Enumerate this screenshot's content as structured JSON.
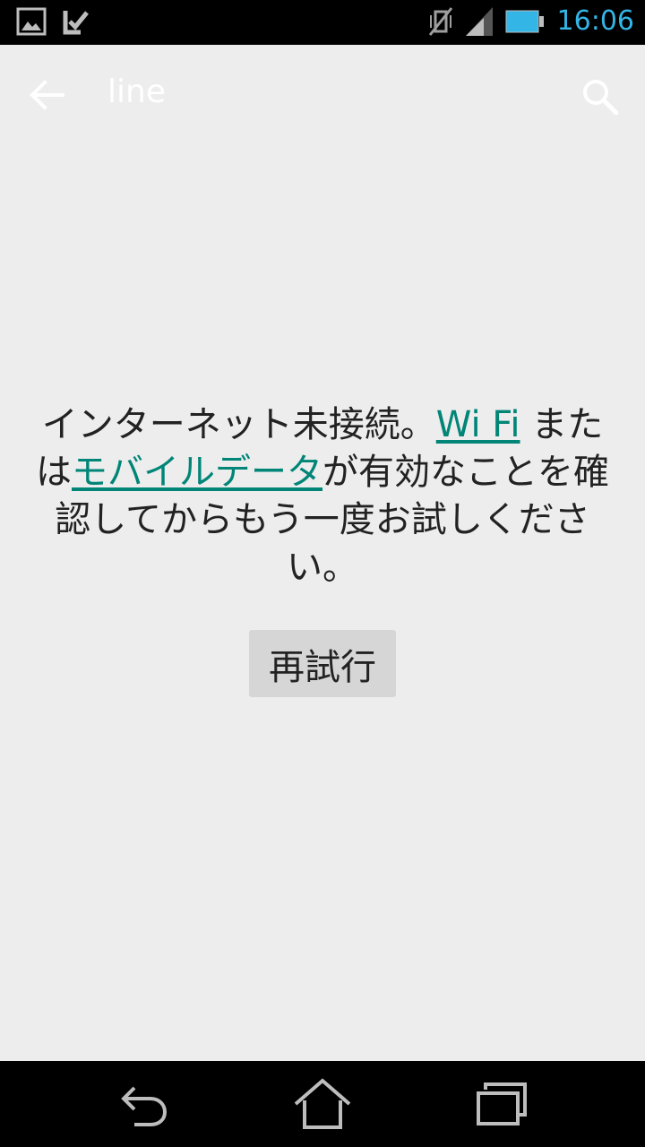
{
  "status_bar": {
    "time": "16:06",
    "left_icons": [
      "image-notification-icon",
      "task-check-notification-icon"
    ],
    "right_icons": [
      "vibrate-off-icon",
      "signal-icon",
      "battery-icon"
    ],
    "clock_color": "#33b5e5"
  },
  "action_bar": {
    "title": "line",
    "back_icon": "arrow-left-icon",
    "search_icon": "search-icon"
  },
  "message": {
    "text_1": "インターネット未接続。",
    "link_wifi": "Wi Fi",
    "text_2": " または",
    "link_mobile": "モバイルデータ",
    "text_3": "が有効なことを確認してからもう一度お試しください。",
    "link_color": "#008577"
  },
  "retry_button": {
    "label": "再試行"
  },
  "nav_bar": {
    "icons": [
      "nav-back-icon",
      "nav-home-icon",
      "nav-recents-icon"
    ]
  }
}
